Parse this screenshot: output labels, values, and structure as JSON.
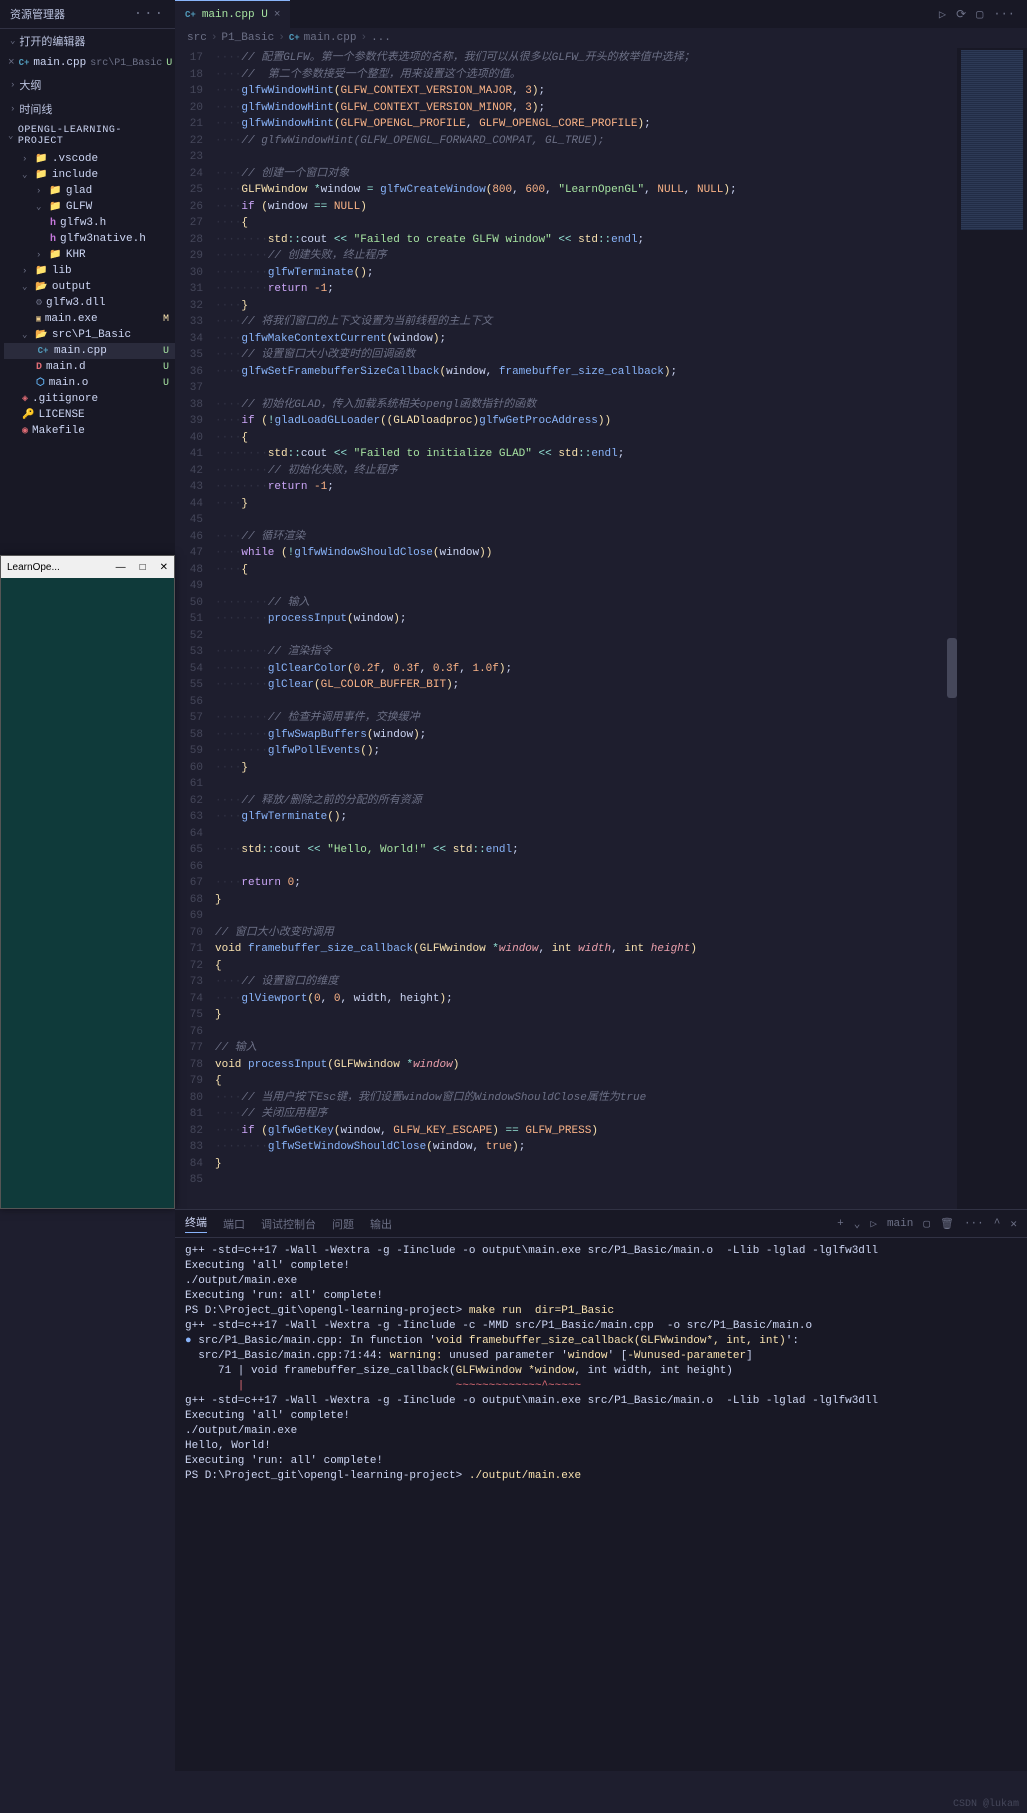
{
  "sidebar": {
    "title": "资源管理器",
    "openEditors": "打开的编辑器",
    "outline": "大纲",
    "timeline": "时间线",
    "projectName": "OPENGL-LEARNING-PROJECT",
    "editor": {
      "name": "main.cpp",
      "path": "src\\P1_Basic",
      "status": "U"
    },
    "tree": {
      "vscode": ".vscode",
      "include": "include",
      "glad": "glad",
      "GLFW": "GLFW",
      "glfw3h": "glfw3.h",
      "glfw3native": "glfw3native.h",
      "KHR": "KHR",
      "lib": "lib",
      "output": "output",
      "glfw3dll": "glfw3.dll",
      "mainexe": "main.exe",
      "srcP1": "src\\P1_Basic",
      "maincpp": "main.cpp",
      "maind": "main.d",
      "maino": "main.o",
      "gitignore": ".gitignore",
      "license": "LICENSE",
      "makefile": "Makefile"
    }
  },
  "tab": {
    "label": "main.cpp U"
  },
  "breadcrumb": {
    "src": "src",
    "p1": "P1_Basic",
    "file": "main.cpp",
    "end": "..."
  },
  "lineStart": 17,
  "lineEnd": 85,
  "overlay": {
    "title": "LearnOpe..."
  },
  "terminal": {
    "tabs": {
      "t1": "终端",
      "t2": "端口",
      "t3": "调试控制台",
      "t4": "问题",
      "t5": "输出"
    },
    "shell": "main",
    "l1": "g++ -std=c++17 -Wall -Wextra -g -Iinclude -o output\\main.exe src/P1_Basic/main.o  -Llib -lglad -lglfw3dll",
    "l2": "Executing 'all' complete!",
    "l3": "./output/main.exe",
    "l4": "Executing 'run: all' complete!",
    "l5p": "PS D:\\Project_git\\opengl-learning-project> ",
    "l5c": "make run  dir=P1_Basic",
    "l6": "g++ -std=c++17 -Wall -Wextra -g -Iinclude -c -MMD src/P1_Basic/main.cpp  -o src/P1_Basic/main.o",
    "l7a": "src/P1_Basic/main.cpp: In function '",
    "l7b": "void framebuffer_size_callback(GLFWwindow*, int, int)",
    "l7c": "':",
    "l8a": "src/P1_Basic/main.cpp:71:44: ",
    "l8b": "warning: ",
    "l8c": "unused parameter '",
    "l8d": "window",
    "l8e": "' [",
    "l8f": "-Wunused-parameter",
    "l8g": "]",
    "l9a": "   71 | void framebuffer_size_callback(",
    "l9b": "GLFWwindow *window",
    "l9c": ", int width, int height)",
    "l10": "      |                                ~~~~~~~~~~~~~^~~~~~",
    "l11": "g++ -std=c++17 -Wall -Wextra -g -Iinclude -o output\\main.exe src/P1_Basic/main.o  -Llib -lglad -lglfw3dll",
    "l12": "Executing 'all' complete!",
    "l13": "./output/main.exe",
    "l14": "Hello, World!",
    "l15": "Executing 'run: all' complete!",
    "l16p": "PS D:\\Project_git\\opengl-learning-project> ",
    "l16c": "./output/main.exe"
  },
  "watermark": "CSDN @lukam"
}
